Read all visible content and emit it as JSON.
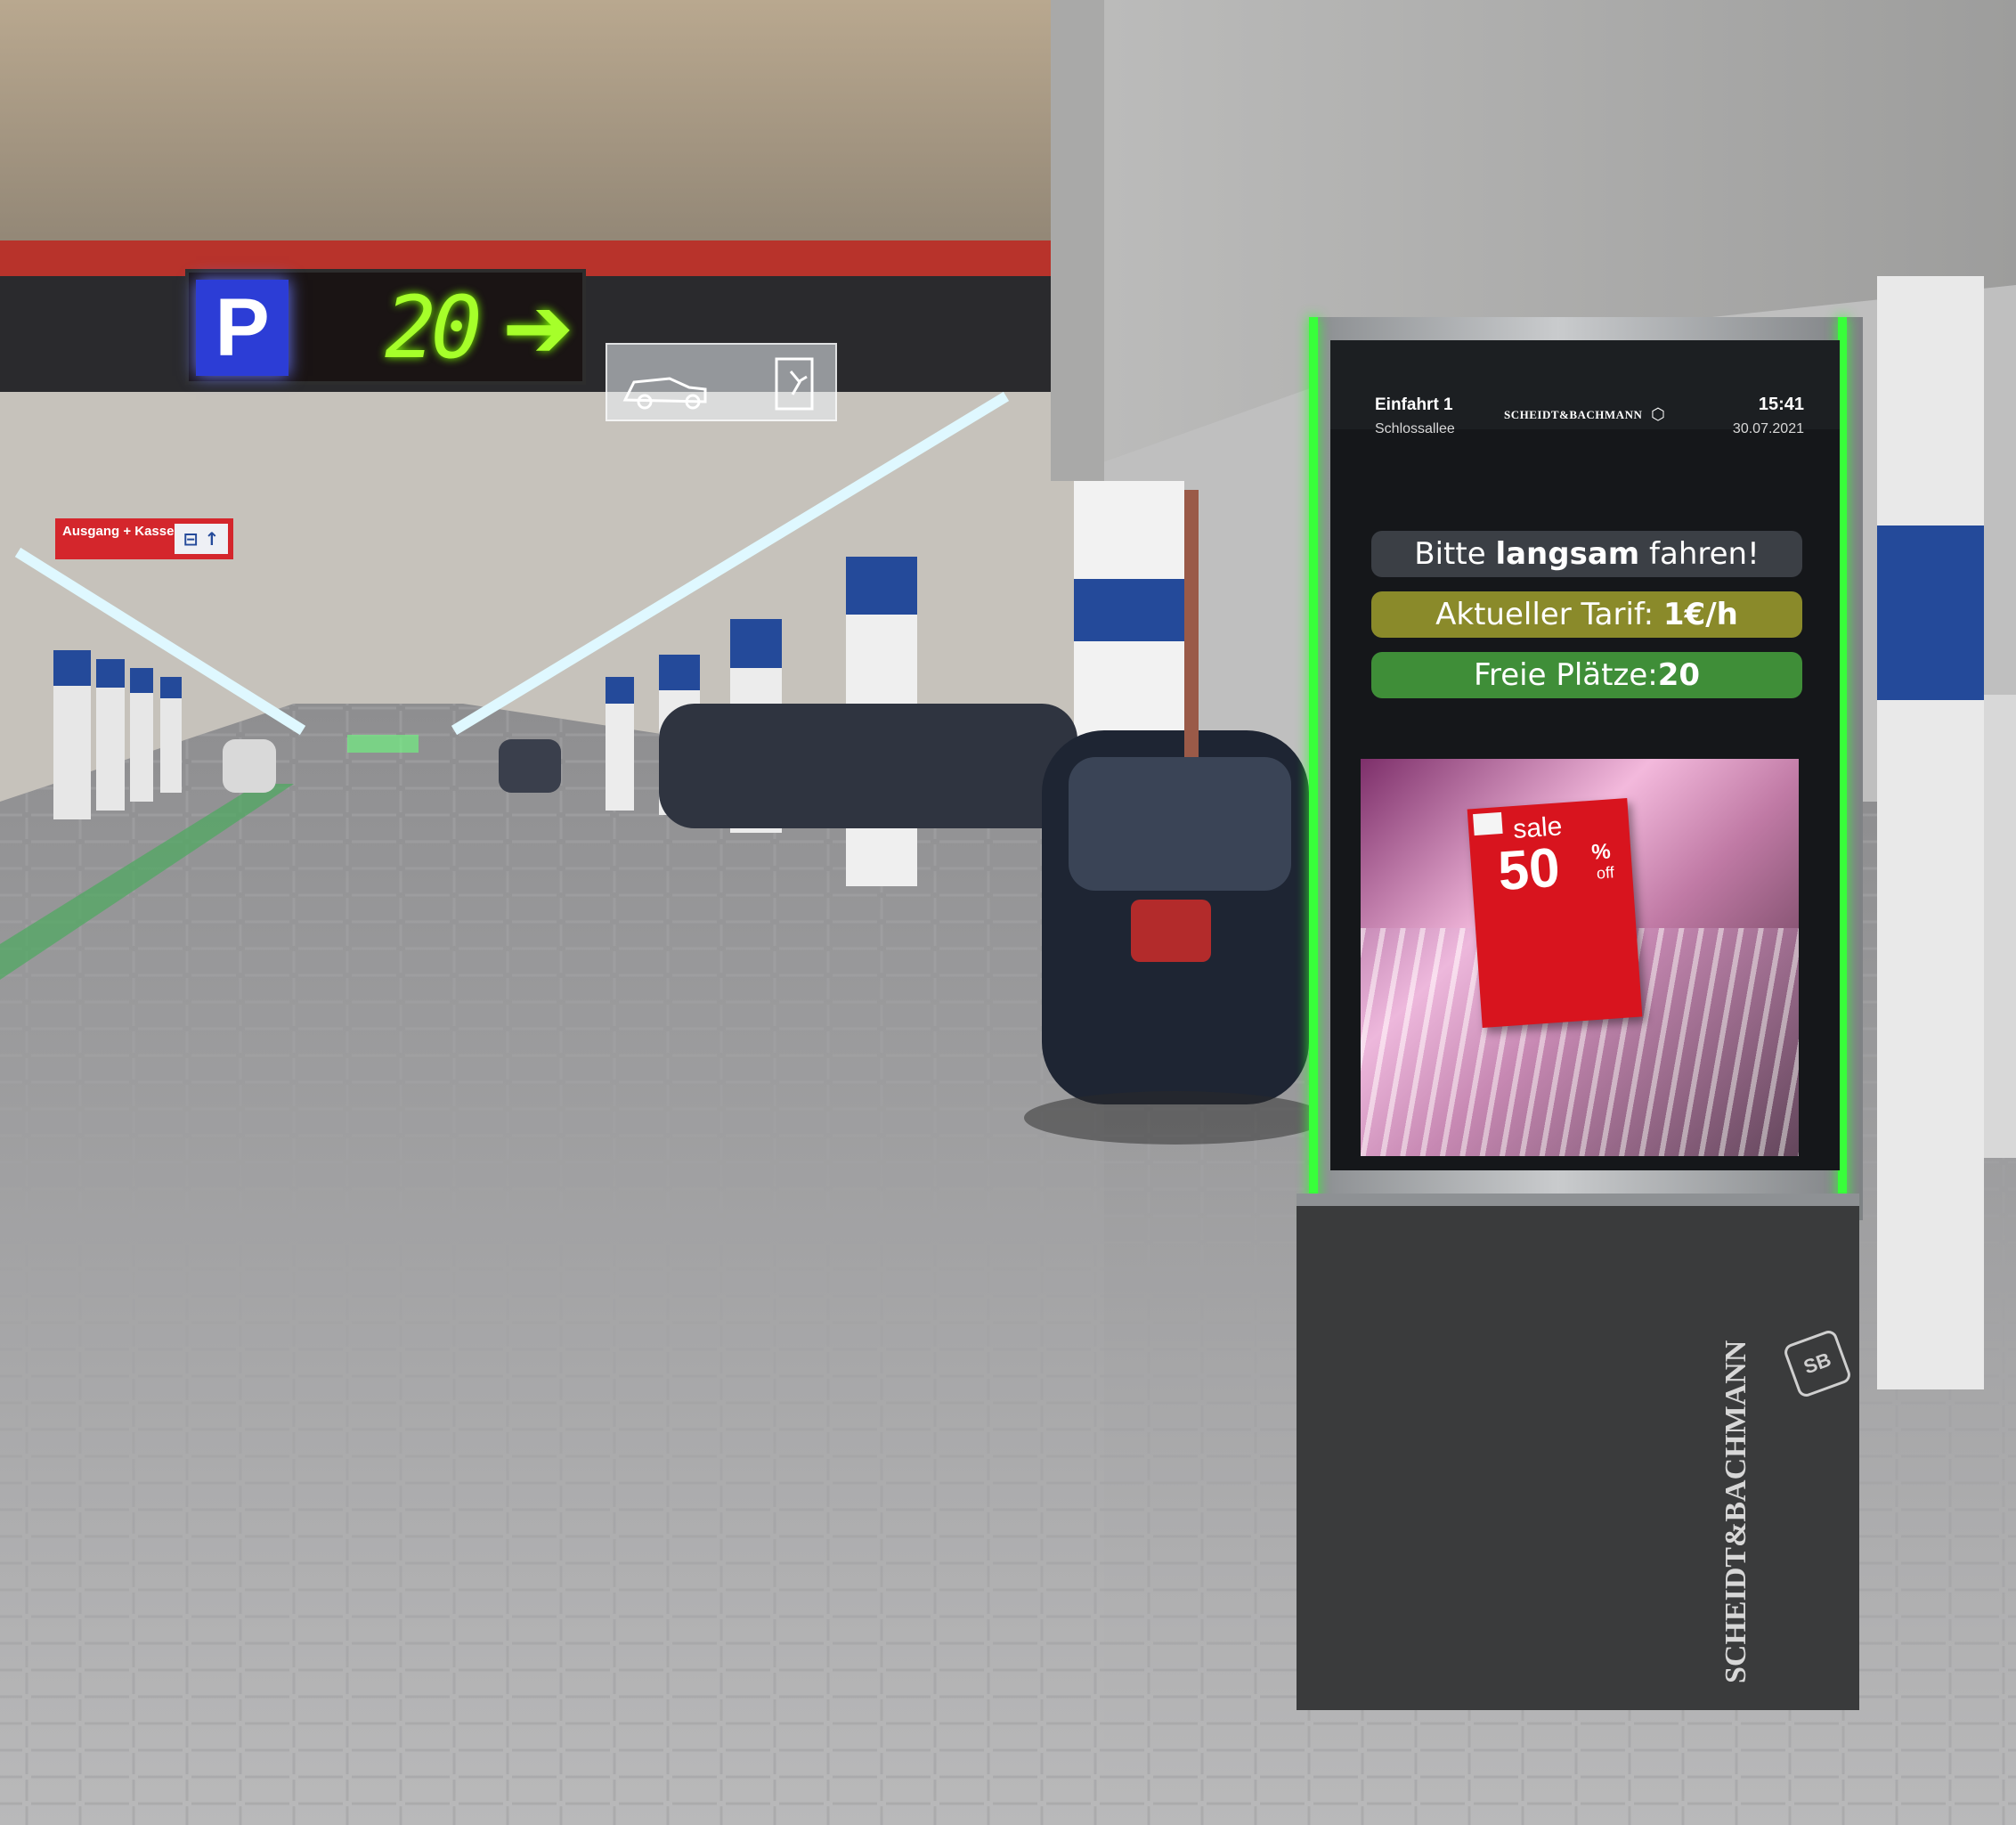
{
  "overhead_sign": {
    "letter": "P",
    "free_count": "20",
    "arrow": "➔"
  },
  "wall_sign": {
    "label": "Ausgang + Kasse",
    "icons": "⊟ ↑"
  },
  "kiosk": {
    "header": {
      "entrance": "Einfahrt 1",
      "street": "Schlossallee",
      "brand": "SCHEIDT&BACHMANN",
      "time": "15:41",
      "date": "30.07.2021"
    },
    "messages": {
      "slow_prefix": "Bitte ",
      "slow_bold": "langsam",
      "slow_suffix": " fahren!",
      "tariff_prefix": "Aktueller Tarif: ",
      "tariff_value": "1€/h",
      "free_prefix": "Freie Plätze:",
      "free_value": "20"
    },
    "ad": {
      "sale": "sale",
      "percent": "50",
      "percent_symbol": "%",
      "off": "off"
    },
    "base_brand": "SCHEIDT&BACHMANN",
    "base_logo": "SB"
  },
  "colors": {
    "accent_green": "#38ff3a",
    "sign_blue": "#2c3dd6",
    "tariff_bar": "#8a8a2a",
    "free_bar": "#3f8e38",
    "sale_red": "#d8141e"
  }
}
